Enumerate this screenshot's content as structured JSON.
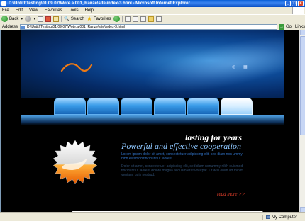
{
  "window": {
    "title": "D:\\Untitl\\Testing\\01.09.07\\Wote.a.001_Ranze\\site\\index-3.html - Microsoft Internet Explorer"
  },
  "menu": [
    "File",
    "Edit",
    "View",
    "Favorites",
    "Tools",
    "Help"
  ],
  "toolbar": {
    "back_label": "Back",
    "search_label": "Search",
    "favorites_label": "Favorites"
  },
  "address": {
    "label": "Address",
    "value": "D:\\Untitl\\Testing\\01.09.07\\Wote.a.001_Ranze\\site\\index-3.html",
    "go_label": "Go",
    "links_label": "Links"
  },
  "site": {
    "tagline_1": "lasting for years",
    "tagline_2": "Powerful and effective cooperation",
    "paragraph_1": "Lorem ipsum dolor sit amet, consectetuer adipiscing elit, sed diam non ummy nibh euismod tincidunt ut laoreet.",
    "paragraph_2": "Dolor sit amet, consectetuer adipiscing elit, sed diam nonummy nibh euismod tincidunt ut laoreet dolore magna aliquam erat volutpat. Ut wisi enim ad minim veniam, quis nostrud.",
    "read_more": "read more >>",
    "nav_tabs": 6,
    "active_tab": 6
  },
  "status": {
    "text": "",
    "zone": "My Computer"
  },
  "colors": {
    "header_blue": "#0d4a97",
    "tab_blue": "#3a9ce8",
    "tagline_blue": "#8ec7ff",
    "readmore_red": "#e8402c",
    "badge_orange": "#f07a12"
  }
}
